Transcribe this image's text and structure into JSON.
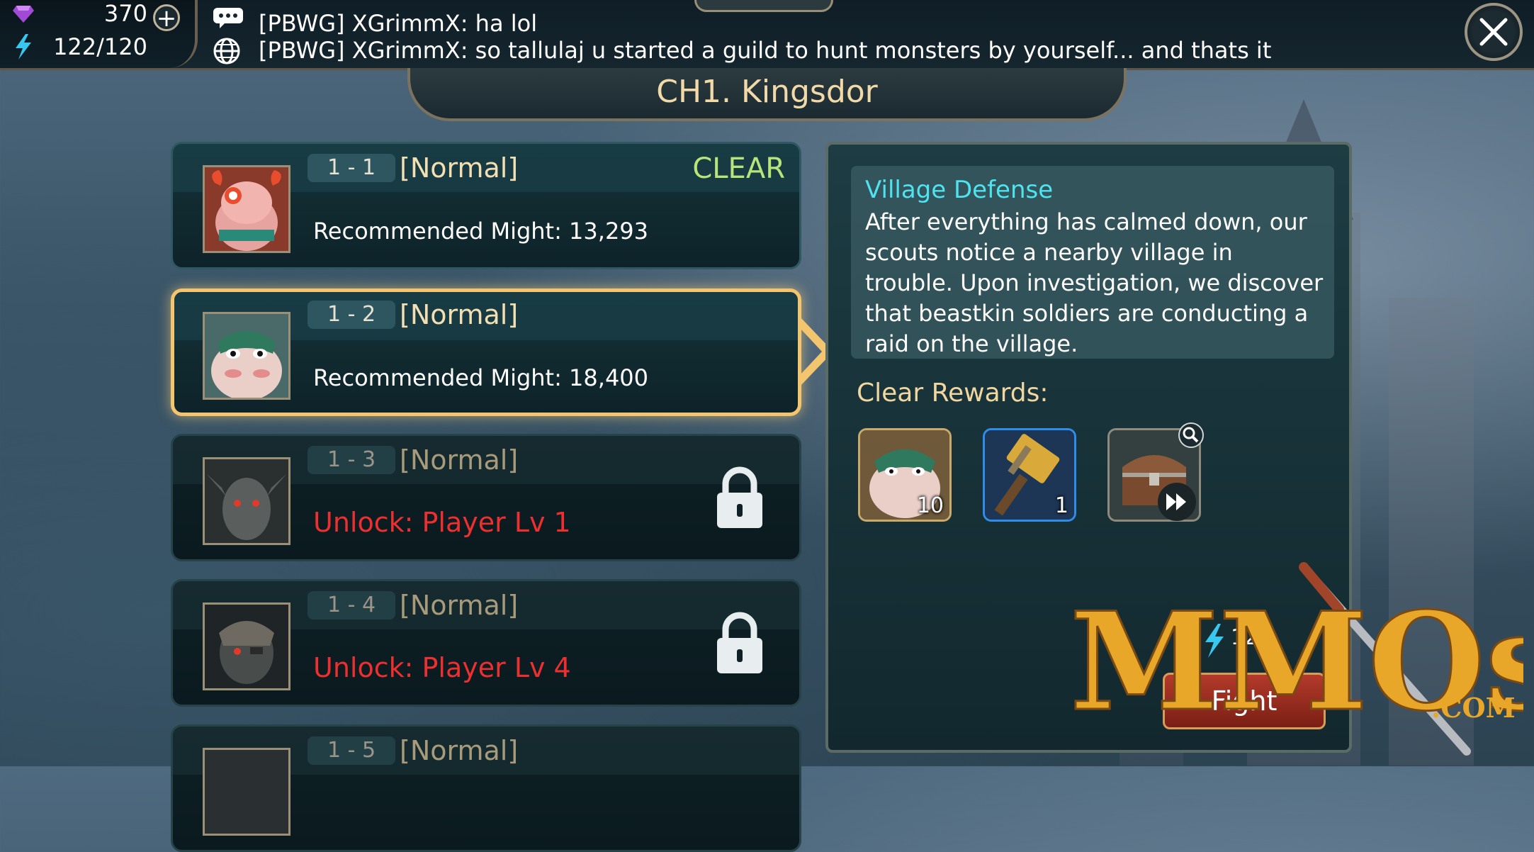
{
  "resources": {
    "gems": "370",
    "stamina": "122/120"
  },
  "chat": {
    "line1": "[PBWG] XGrimmX: ha lol",
    "line2": "[PBWG] XGrimmX: so tallulaj u started a guild to hunt monsters by yourself... and thats it"
  },
  "chapter": {
    "title": "CH1. Kingsdor"
  },
  "stages": [
    {
      "number": "1 - 1",
      "difficulty": "[Normal]",
      "might": "Recommended Might: 13,293",
      "status": "CLEAR",
      "locked": false,
      "selected": false
    },
    {
      "number": "1 - 2",
      "difficulty": "[Normal]",
      "might": "Recommended Might: 18,400",
      "locked": false,
      "selected": true
    },
    {
      "number": "1 - 3",
      "difficulty": "[Normal]",
      "unlock": "Unlock: Player Lv 1",
      "locked": true
    },
    {
      "number": "1 - 4",
      "difficulty": "[Normal]",
      "unlock": "Unlock: Player Lv 4",
      "locked": true
    },
    {
      "number": "1 - 5",
      "difficulty": "[Normal]",
      "locked": true
    }
  ],
  "detail": {
    "title": "Village Defense",
    "description": "After everything has calmed down, our scouts notice a nearby village in trouble. Upon investigation, we discover that beastkin soldiers are conducting a raid on the village.",
    "rewards_label": "Clear Rewards:",
    "rewards": [
      {
        "name": "toad-hero-shard",
        "qty": "10"
      },
      {
        "name": "hammer",
        "qty": "1"
      },
      {
        "name": "treasure-chest",
        "qty": ""
      }
    ],
    "fight_cost": "12",
    "fight_label": "Fight"
  },
  "watermark": {
    "text": "MMOs",
    "suffix": ".COM"
  },
  "colors": {
    "selected_border": "#f3c56e",
    "clear": "#b7e57a",
    "unlock_red": "#ee2f2f",
    "title_cyan": "#4fe3f0"
  }
}
